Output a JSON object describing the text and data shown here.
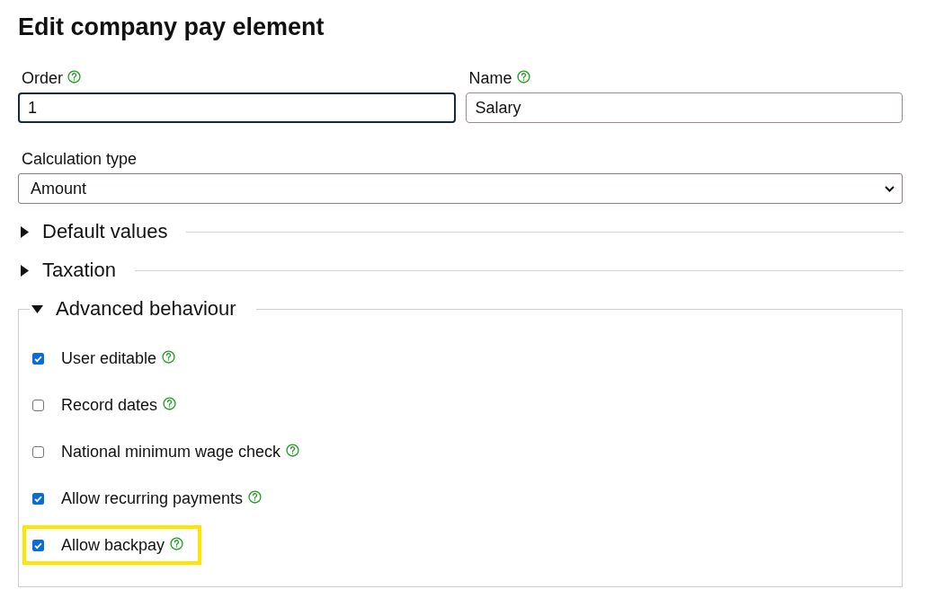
{
  "title": "Edit company pay element",
  "fields": [
    {
      "kind": "input",
      "label": "Order",
      "help": true,
      "value": "1",
      "focused": true
    },
    {
      "kind": "input",
      "label": "Name",
      "help": true,
      "value": "Salary",
      "focused": false
    },
    {
      "kind": "select",
      "label": "Calculation type",
      "help": false,
      "value": "Amount"
    }
  ],
  "sections": [
    {
      "label": "Default values",
      "expanded": false
    },
    {
      "label": "Taxation",
      "expanded": false
    },
    {
      "label": "Advanced behaviour",
      "expanded": true,
      "options": [
        {
          "label": "User editable",
          "checked": true,
          "help": true,
          "highlighted": false
        },
        {
          "label": "Record dates",
          "checked": false,
          "help": true,
          "highlighted": false
        },
        {
          "label": "National minimum wage check",
          "checked": false,
          "help": true,
          "highlighted": false
        },
        {
          "label": "Allow recurring payments",
          "checked": true,
          "help": true,
          "highlighted": false
        },
        {
          "label": "Allow backpay",
          "checked": true,
          "help": true,
          "highlighted": true
        }
      ]
    }
  ]
}
